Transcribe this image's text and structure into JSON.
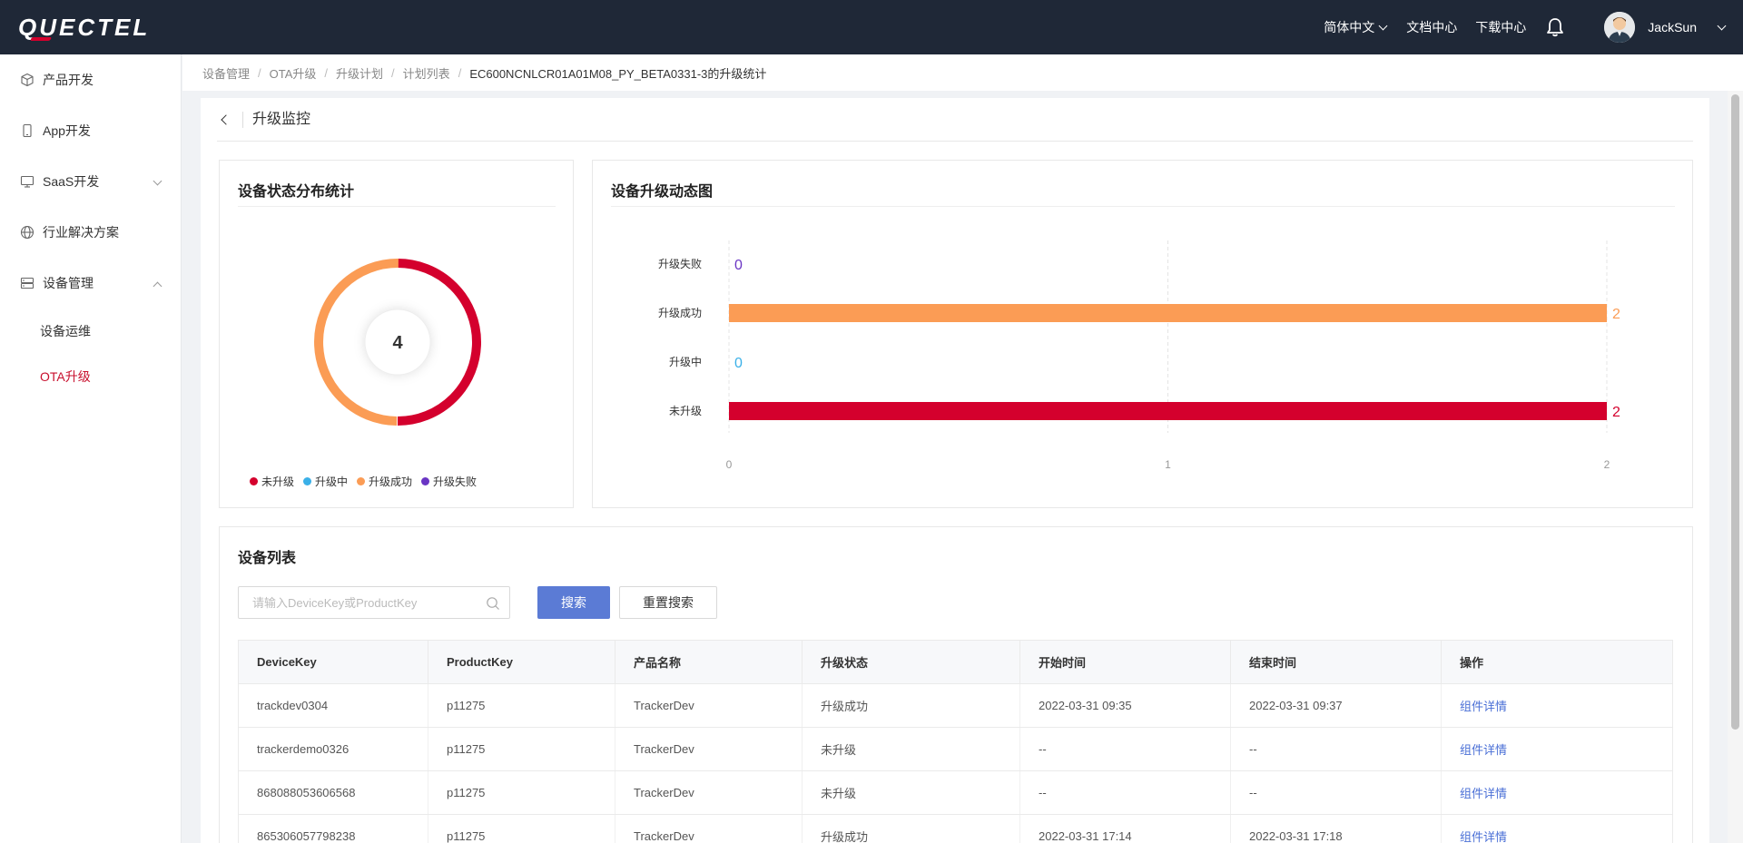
{
  "header": {
    "logo": "QUECTEL",
    "language": "简体中文",
    "docs": "文档中心",
    "downloads": "下载中心",
    "username": "JackSun"
  },
  "sidebar": {
    "items": [
      {
        "label": "产品开发",
        "icon": "cube-icon"
      },
      {
        "label": "App开发",
        "icon": "phone-icon"
      },
      {
        "label": "SaaS开发",
        "icon": "monitor-icon",
        "expandable": true
      },
      {
        "label": "行业解决方案",
        "icon": "globe-icon"
      },
      {
        "label": "设备管理",
        "icon": "server-icon",
        "expanded": true
      }
    ],
    "subitems": [
      {
        "label": "设备运维"
      },
      {
        "label": "OTA升级",
        "active": true
      }
    ],
    "active_color": "#c8102e"
  },
  "breadcrumb": {
    "items": [
      "设备管理",
      "OTA升级",
      "升级计划",
      "计划列表"
    ],
    "current": "EC600NCNLCR01A01M08_PY_BETA0331-3的升级统计"
  },
  "page": {
    "title": "升级监控"
  },
  "donut_card": {
    "title": "设备状态分布统计",
    "total": "4"
  },
  "bar_card": {
    "title": "设备升级动态图"
  },
  "chart_data": [
    {
      "type": "pie",
      "title": "设备状态分布统计",
      "center_label": "4",
      "categories": [
        "未升级",
        "升级中",
        "升级成功",
        "升级失败"
      ],
      "values": [
        2,
        0,
        2,
        0
      ],
      "colors": [
        "#d4002d",
        "#3ab0e8",
        "#fb9c55",
        "#6a35c4"
      ],
      "legend": "bottom"
    },
    {
      "type": "bar",
      "orientation": "horizontal",
      "title": "设备升级动态图",
      "categories": [
        "升级失败",
        "升级成功",
        "升级中",
        "未升级"
      ],
      "values": [
        0,
        2,
        0,
        2
      ],
      "colors": [
        "#6a35c4",
        "#fb9c55",
        "#3ab0e8",
        "#d4002d"
      ],
      "xlim": [
        0,
        2
      ],
      "xticks": [
        "0",
        "1",
        "2"
      ],
      "grid": true
    }
  ],
  "device_list": {
    "title": "设备列表",
    "search_placeholder": "请输入DeviceKey或ProductKey",
    "search_button": "搜索",
    "reset_button": "重置搜索",
    "columns": [
      "DeviceKey",
      "ProductKey",
      "产品名称",
      "升级状态",
      "开始时间",
      "结束时间",
      "操作"
    ],
    "rows": [
      {
        "devicekey": "trackdev0304",
        "productkey": "p11275",
        "product": "TrackerDev",
        "status": "升级成功",
        "start": "2022-03-31 09:35",
        "end": "2022-03-31 09:37",
        "action": "组件详情"
      },
      {
        "devicekey": "trackerdemo0326",
        "productkey": "p11275",
        "product": "TrackerDev",
        "status": "未升级",
        "start": "--",
        "end": "--",
        "action": "组件详情"
      },
      {
        "devicekey": "868088053606568",
        "productkey": "p11275",
        "product": "TrackerDev",
        "status": "未升级",
        "start": "--",
        "end": "--",
        "action": "组件详情"
      },
      {
        "devicekey": "865306057798238",
        "productkey": "p11275",
        "product": "TrackerDev",
        "status": "升级成功",
        "start": "2022-03-31 17:14",
        "end": "2022-03-31 17:18",
        "action": "组件详情"
      }
    ]
  }
}
